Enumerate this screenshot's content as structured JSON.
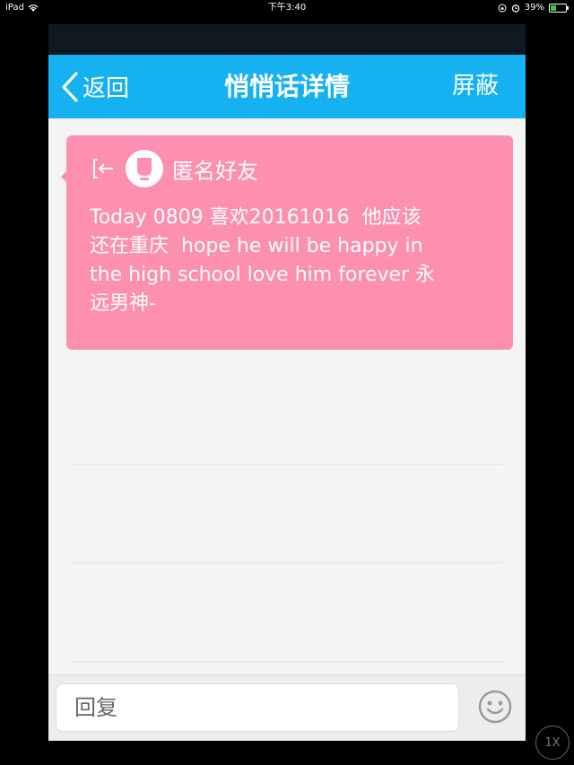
{
  "status_bar": {
    "device": "iPad",
    "time": "下午3:40",
    "battery": "39%",
    "battery_level": 0.39
  },
  "navbar": {
    "back_label": "返回",
    "title": "悄悄话详情",
    "block_label": "屏蔽"
  },
  "message": {
    "sender": "匿名好友",
    "text": "Today 0809 喜欢20161016  他应该\n还在重庆  hope he will be happy in\nthe high school love him forever 永\n远男神-"
  },
  "reply": {
    "placeholder": "回复"
  },
  "zoom": {
    "label": "1X"
  },
  "colors": {
    "navbar": "#15b1f1",
    "message_card": "#fd8fb0",
    "background": "#f4f4f4"
  },
  "icons": {
    "back": "chevron-left-icon",
    "enter": "enter-arrow-icon",
    "avatar": "anonymous-avatar-icon",
    "emoji": "smiley-icon",
    "wifi": "wifi-icon",
    "lock": "rotation-lock-icon",
    "alarm": "alarm-icon"
  }
}
